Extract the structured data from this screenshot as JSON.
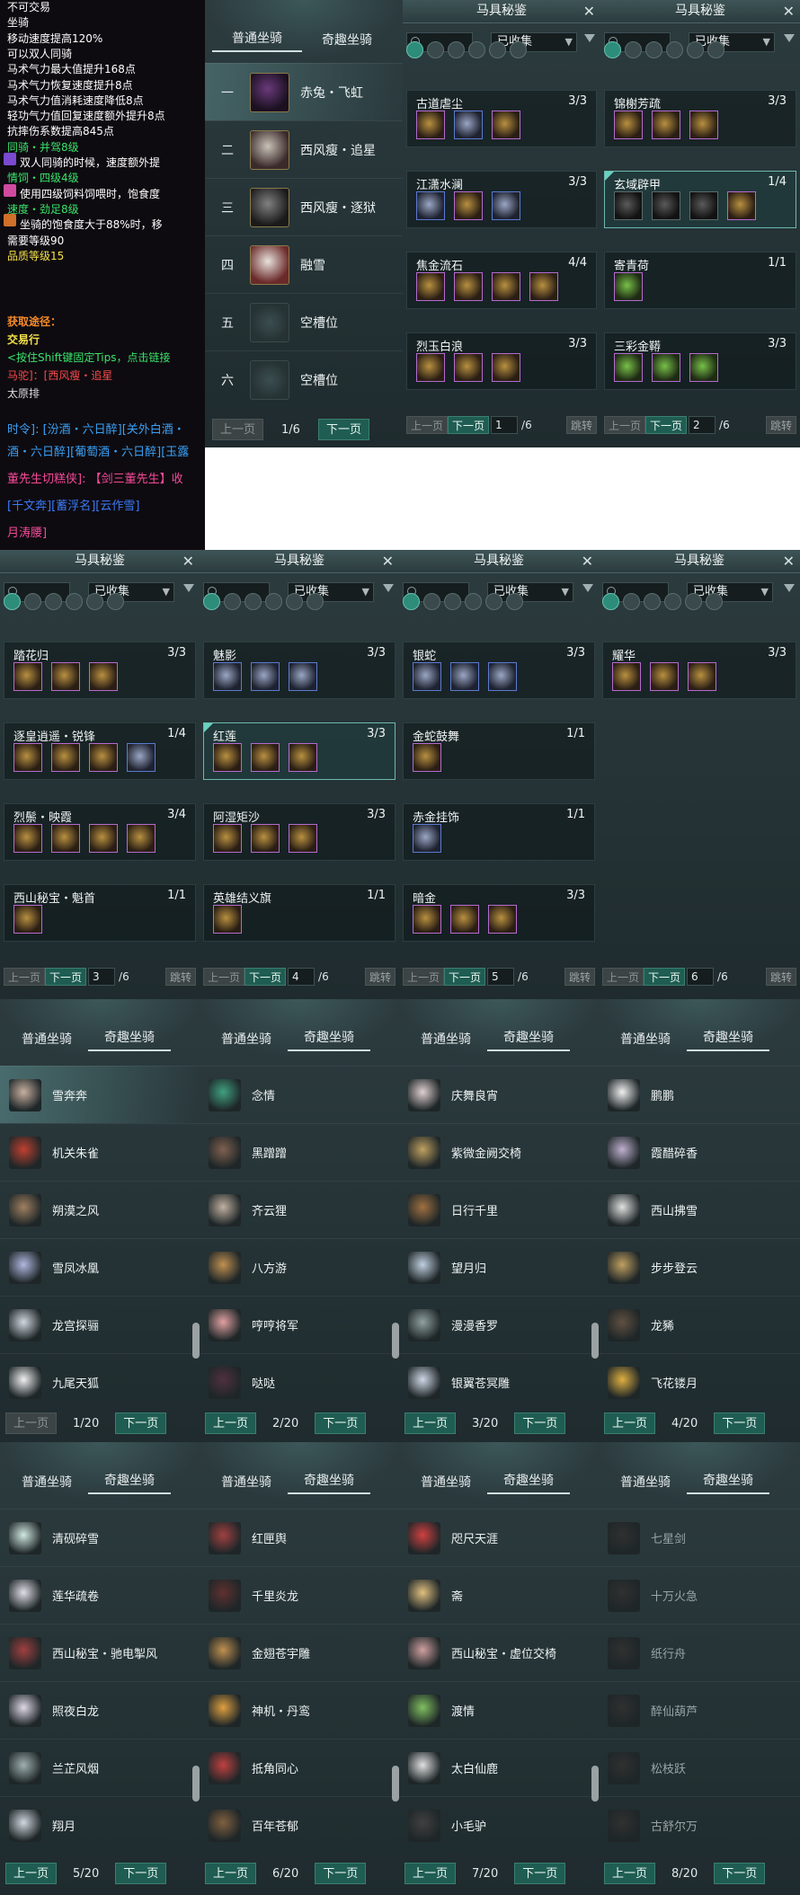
{
  "tooltip": {
    "lines": [
      {
        "text": "不可交易",
        "color": "#ffffff"
      },
      {
        "text": "坐骑",
        "color": "#ffffff"
      },
      {
        "text": "移动速度提高120%",
        "color": "#ffffff"
      },
      {
        "text": "可以双人同骑",
        "color": "#ffffff"
      },
      {
        "text": "马术气力最大值提升168点",
        "color": "#ffffff"
      },
      {
        "text": "马术气力恢复速度提升8点",
        "color": "#ffffff"
      },
      {
        "text": "马术气力值消耗速度降低8点",
        "color": "#ffffff"
      },
      {
        "text": "轻功气力值回复速度额外提升8点",
        "color": "#ffffff"
      },
      {
        "text": "抗摔伤系数提高845点",
        "color": "#ffffff"
      },
      {
        "text": "同骑・并驾8级",
        "color": "#39e26a"
      },
      {
        "text": "双人同骑的时候，速度额外提",
        "color": "#ffffff"
      },
      {
        "text": "情饲・四级4级",
        "color": "#39e26a"
      },
      {
        "text": "使用四级饲料饲喂时，饱食度",
        "color": "#ffffff"
      },
      {
        "text": "速度・劲足8级",
        "color": "#39e26a"
      },
      {
        "text": "坐骑的饱食度大于88%时，移",
        "color": "#ffffff"
      },
      {
        "text": "需要等级90",
        "color": "#ffffff"
      },
      {
        "text": "品质等级15",
        "color": "#f5e14a"
      },
      {
        "text": "获取途径：",
        "color": "#f58a2a"
      },
      {
        "text": "交易行",
        "color": "#f5e14a"
      },
      {
        "text": "<按住Shift键固定Tips，点击链接",
        "color": "#39e26a"
      },
      {
        "text": "马驼]：[西风瘦・追星",
        "color": "#f54a4a"
      },
      {
        "text": "太原排",
        "color": "#dddddd"
      }
    ],
    "chat": [
      {
        "text": "时令]: [汾酒・六日醉][关外白酒・",
        "color": "#3aa0f5"
      },
      {
        "text": "酒・六日醉][葡萄酒・六日醉][玉露",
        "color": "#3aa0f5"
      },
      {
        "text": "董先生切糕侠]: 【剑三董先生】收",
        "color": "#f54a9a"
      },
      {
        "text": "[千文奔][蓄浮名][云作雪]",
        "color": "#3a7af5"
      },
      {
        "text": "月涛腰]",
        "color": "#f54a9a"
      }
    ]
  },
  "mount_panel_1": {
    "tabs": [
      "普通坐骑",
      "奇趣坐骑"
    ],
    "rows": [
      {
        "num": "一",
        "name": "赤兔・飞虹"
      },
      {
        "num": "二",
        "name": "西风瘦・追星"
      },
      {
        "num": "三",
        "name": "西风瘦・逐狱"
      },
      {
        "num": "四",
        "name": "融雪"
      },
      {
        "num": "五",
        "name": "空槽位"
      },
      {
        "num": "六",
        "name": "空槽位"
      }
    ],
    "prev": "上一页",
    "page": "1/6",
    "next": "下一页"
  },
  "journal": {
    "title": "马具秘鉴",
    "filter": "已收集",
    "prev": "上一页",
    "next": "下一页",
    "jump": "跳转",
    "pages": [
      {
        "page": "1",
        "total": "/6",
        "sets": [
          {
            "name": "古道虐尘",
            "count": "3/3"
          },
          {
            "name": "江潇水澜",
            "count": "3/3"
          },
          {
            "name": "焦金流石",
            "count": "4/4"
          },
          {
            "name": "烈玉白浪",
            "count": "3/3"
          }
        ]
      },
      {
        "page": "2",
        "total": "/6",
        "sets": [
          {
            "name": "锦榭芳疏",
            "count": "3/3"
          },
          {
            "name": "玄域辟甲",
            "count": "1/4"
          },
          {
            "name": "寄青荷",
            "count": "1/1"
          },
          {
            "name": "三彩金鞯",
            "count": "3/3"
          }
        ]
      },
      {
        "page": "3",
        "total": "/6",
        "sets": [
          {
            "name": "踏花归",
            "count": "3/3"
          },
          {
            "name": "逐皇逍遥・锐锋",
            "count": "1/4"
          },
          {
            "name": "烈鬃・映霞",
            "count": "3/4"
          },
          {
            "name": "西山秘宝・魁首",
            "count": "1/1"
          }
        ]
      },
      {
        "page": "4",
        "total": "/6",
        "sets": [
          {
            "name": "魅影",
            "count": "3/3"
          },
          {
            "name": "红莲",
            "count": "3/3"
          },
          {
            "name": "阿湿矩沙",
            "count": "3/3"
          },
          {
            "name": "英雄结义旗",
            "count": "1/1"
          }
        ]
      },
      {
        "page": "5",
        "total": "/6",
        "sets": [
          {
            "name": "银蛇",
            "count": "3/3"
          },
          {
            "name": "金蛇鼓舞",
            "count": "1/1"
          },
          {
            "name": "赤金挂饰",
            "count": "1/1"
          },
          {
            "name": "暗金",
            "count": "3/3"
          }
        ]
      },
      {
        "page": "6",
        "total": "/6",
        "sets": [
          {
            "name": "耀华",
            "count": "3/3"
          }
        ]
      }
    ]
  },
  "fun_mounts": {
    "tabs": [
      "普通坐骑",
      "奇趣坐骑"
    ],
    "prev": "上一页",
    "next": "下一页",
    "pages": [
      {
        "page": "1/20",
        "names": [
          "雪奔奔",
          "机关朱雀",
          "朔漠之风",
          "雪凤冰凰",
          "龙宫探骊",
          "九尾天狐"
        ]
      },
      {
        "page": "2/20",
        "names": [
          "念情",
          "黑蹭蹭",
          "齐云狸",
          "八方游",
          "哼哼将军",
          "哒哒"
        ]
      },
      {
        "page": "3/20",
        "names": [
          "庆舞良宵",
          "紫微金阙交椅",
          "日行千里",
          "望月归",
          "漫漫香罗",
          "银翼苍冥雕"
        ]
      },
      {
        "page": "4/20",
        "names": [
          "鹏鹏",
          "霞醋碎香",
          "西山拂雪",
          "步步登云",
          "龙豨",
          "飞花镂月"
        ]
      },
      {
        "page": "5/20",
        "names": [
          "清砚碎雪",
          "莲华疏卷",
          "西山秘宝・驰电掣风",
          "照夜白龙",
          "兰芷风烟",
          "翔月"
        ]
      },
      {
        "page": "6/20",
        "names": [
          "红匣舆",
          "千里炎龙",
          "金翅苍宇雕",
          "神机・丹鸾",
          "抵角同心",
          "百年苍郁"
        ]
      },
      {
        "page": "7/20",
        "names": [
          "咫尺天涯",
          "斋",
          "西山秘宝・虚位交椅",
          "渡情",
          "太白仙鹿",
          "小毛驴"
        ]
      },
      {
        "page": "8/20",
        "names": [
          "七星剑",
          "十万火急",
          "纸行舟",
          "醉仙葫芦",
          "松枝跃",
          "古舒尔万"
        ]
      }
    ]
  }
}
